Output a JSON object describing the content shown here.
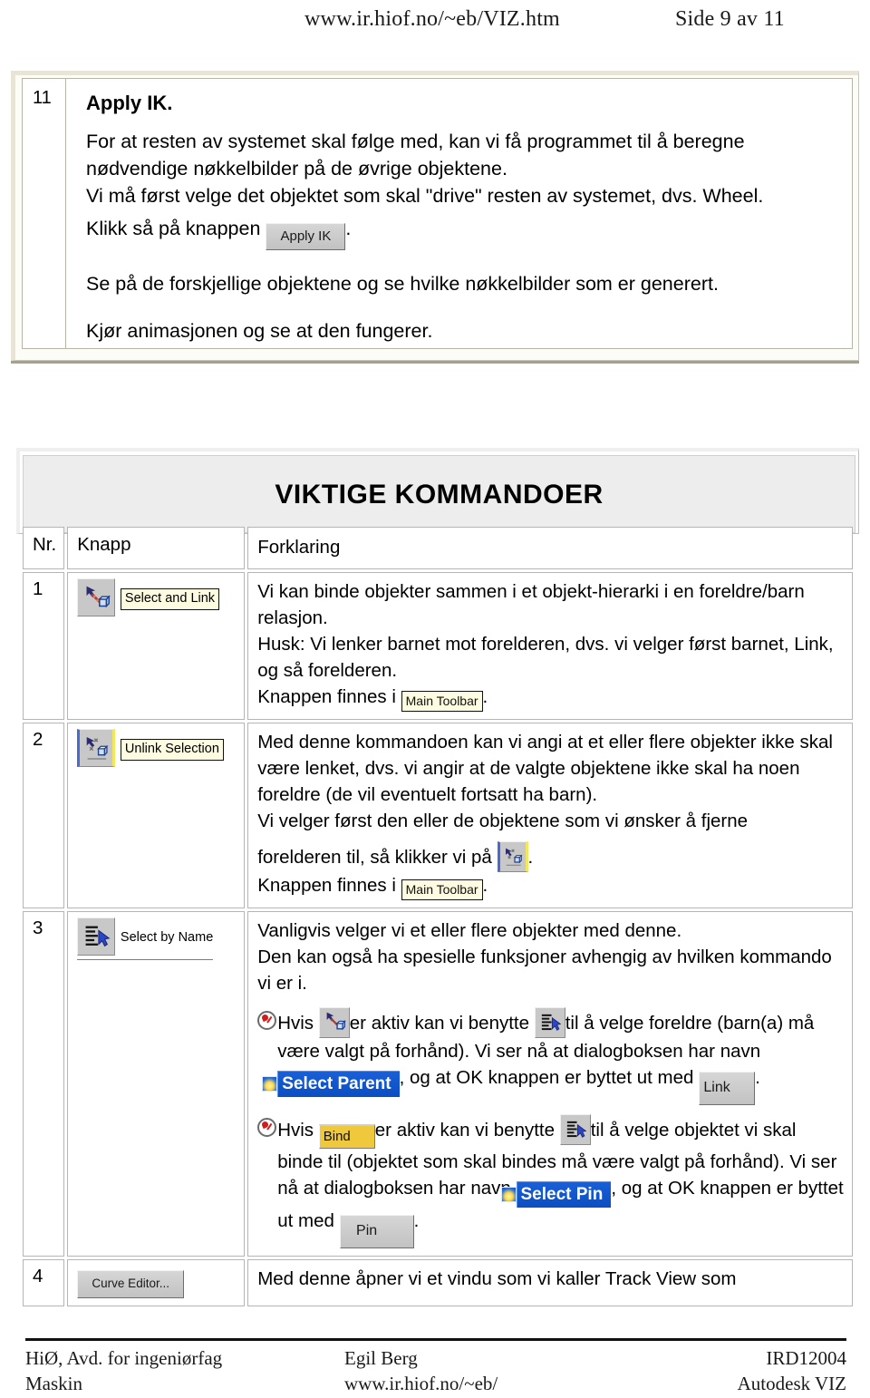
{
  "page_header": {
    "url": "www.ir.hiof.no/~eb/VIZ.htm",
    "page_indicator": "Side 9 av 11"
  },
  "step": {
    "number": "11",
    "title": "Apply IK.",
    "title_suffix": ".",
    "lines": [
      "For at resten av systemet skal følge med, kan vi få programmet til å beregne nødvendige nøkkelbilder på de øvrige objektene.",
      "Vi må først velge det objektet som skal \"drive\" resten av systemet, dvs. Wheel."
    ],
    "click_line_prefix": "Klikk så på knappen",
    "click_line_suffix": ".",
    "apply_ik_button": "Apply IK",
    "line_see": "Se på de forskjellige objektene og se hvilke nøkkelbilder som er generert.",
    "line_run": "Kjør animasjonen og se at den fungerer."
  },
  "section": {
    "title": "VIKTIGE KOMMANDOER"
  },
  "table": {
    "headers": {
      "nr": "Nr.",
      "knapp": "Knapp",
      "forklaring": "Forklaring"
    },
    "rows": [
      {
        "nr": "1",
        "button_icon": "select-and-link-icon",
        "button_caption": "Select and Link",
        "text_lines": [
          "Vi kan binde objekter sammen i et objekt-hierarki i en foreldre/barn relasjon.",
          "Husk: Vi lenker barnet mot forelderen, dvs. vi velger først barnet, Link, og så forelderen."
        ],
        "found_in_prefix": "Knappen finnes i",
        "found_in_tooltip": "Main Toolbar",
        "found_in_suffix": "."
      },
      {
        "nr": "2",
        "button_icon": "unlink-selection-icon",
        "button_caption": "Unlink Selection",
        "text_lines": [
          "Med denne kommandoen kan vi angi at et eller flere objekter ikke skal være lenket, dvs. vi angir at de valgte objektene ikke skal ha noen foreldre (de vil eventuelt fortsatt ha barn).",
          "Vi velger først den eller de objektene som vi ønsker å fjerne"
        ],
        "click_line_prefix": "forelderen til, så klikker vi på",
        "click_line_suffix": ".",
        "found_in_prefix": "Knappen finnes i",
        "found_in_tooltip": "Main Toolbar",
        "found_in_suffix": "."
      },
      {
        "nr": "3",
        "button_icon": "select-by-name-icon",
        "button_caption": "Select by Name",
        "text_lines": [
          "Vanligvis velger vi et eller flere objekter med denne.",
          "Den kan også ha spesielle funksjoner avhengig av hvilken kommando vi er i."
        ],
        "para_a": {
          "t1": "Hvis",
          "t2": "er aktiv kan vi benytte",
          "t3": "til å velge foreldre (barn(a) må være valgt på forhånd). Vi ser nå at dialogboksen har navn",
          "dialog_name": "Select Parent",
          "t4": ", og at OK knappen er byttet ut med",
          "ok_replacement": "Link",
          "t5": "."
        },
        "para_b": {
          "t1": "Hvis",
          "bind_button": "Bind",
          "t2": "er aktiv kan vi benytte",
          "t3": "til å velge objektet vi skal binde til (objektet som skal bindes må være valgt på forhånd). Vi ser nå at dialogboksen har navn",
          "dialog_name": "Select Pin",
          "t4": ",",
          "t5": "og at OK knappen er byttet ut med",
          "ok_replacement": "Pin",
          "t6": "."
        }
      },
      {
        "nr": "4",
        "button_label": "Curve Editor...",
        "text_lines": [
          "Med denne åpner vi et vindu som vi kaller Track View som"
        ]
      }
    ]
  },
  "footer": {
    "left_line1": "HiØ, Avd. for ingeniørfag",
    "left_line2": "Maskin",
    "mid_line1": "Egil Berg",
    "mid_line2": "www.ir.hiof.no/~eb/",
    "right_line1": "IRD12004",
    "right_line2": "Autodesk VIZ"
  }
}
